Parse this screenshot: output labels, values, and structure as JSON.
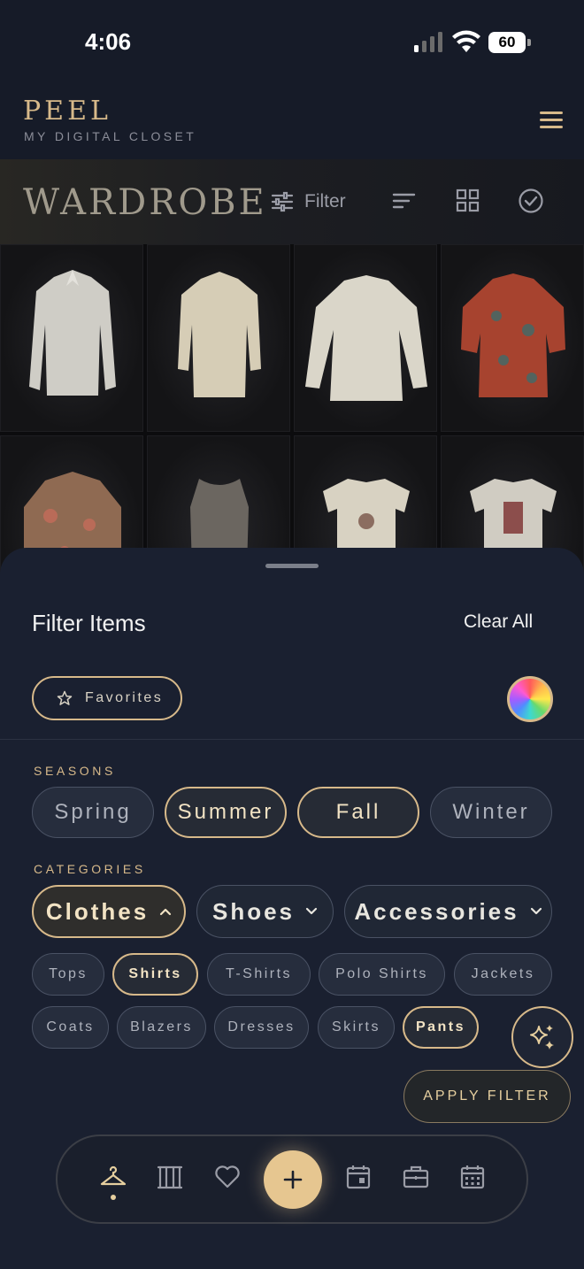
{
  "status_bar": {
    "time": "4:06",
    "battery": "60"
  },
  "header": {
    "logo": "PEEL",
    "tagline": "MY DIGITAL CLOSET"
  },
  "toolbar": {
    "title": "WARDROBE",
    "filter_label": "Filter"
  },
  "filter_sheet": {
    "title": "Filter Items",
    "clear_all": "Clear All",
    "favorites_label": "Favorites",
    "seasons_label": "SEASONS",
    "seasons": [
      {
        "label": "Spring",
        "selected": false
      },
      {
        "label": "Summer",
        "selected": true
      },
      {
        "label": "Fall",
        "selected": true
      },
      {
        "label": "Winter",
        "selected": false
      }
    ],
    "categories_label": "CATEGORIES",
    "categories": [
      {
        "label": "Clothes",
        "selected": true,
        "expanded": true
      },
      {
        "label": "Shoes",
        "selected": false,
        "expanded": false
      },
      {
        "label": "Accessories",
        "selected": false,
        "expanded": false
      }
    ],
    "subcategories": [
      {
        "label": "Tops",
        "selected": false
      },
      {
        "label": "Shirts",
        "selected": true
      },
      {
        "label": "T-Shirts",
        "selected": false
      },
      {
        "label": "Polo Shirts",
        "selected": false
      },
      {
        "label": "Jackets",
        "selected": false
      },
      {
        "label": "Coats",
        "selected": false
      },
      {
        "label": "Blazers",
        "selected": false
      },
      {
        "label": "Dresses",
        "selected": false
      },
      {
        "label": "Skirts",
        "selected": false
      },
      {
        "label": "Pants",
        "selected": true
      }
    ],
    "apply_label": "APPLY FILTER"
  },
  "colors": {
    "accent": "#d7b98a",
    "background": "#161b28",
    "sheet": "#1a2030"
  },
  "bottom_nav": [
    "hanger-icon",
    "wardrobe-icon",
    "heart-icon",
    "add-icon",
    "calendar-day-icon",
    "suitcase-icon",
    "calendar-icon"
  ]
}
